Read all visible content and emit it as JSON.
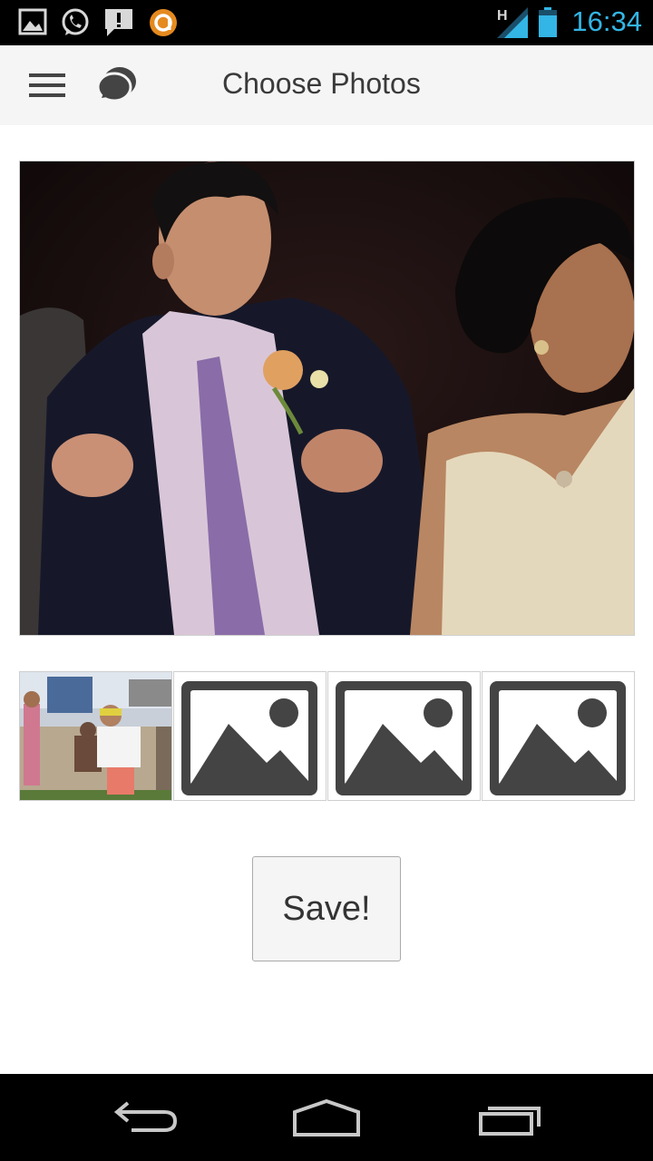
{
  "status_bar": {
    "time": "16:34",
    "network_label": "H",
    "icons": [
      "gallery-icon",
      "whatsapp-icon",
      "alert-icon",
      "avast-icon",
      "signal-icon",
      "battery-icon"
    ]
  },
  "app_bar": {
    "title": "Choose Photos",
    "icons": [
      "menu-icon",
      "chat-icon"
    ]
  },
  "photos": {
    "main": "selected-photo",
    "thumbnails": [
      {
        "type": "photo"
      },
      {
        "type": "placeholder"
      },
      {
        "type": "placeholder"
      },
      {
        "type": "placeholder"
      }
    ]
  },
  "actions": {
    "save_label": "Save!"
  },
  "nav_bar": {
    "icons": [
      "back-icon",
      "home-icon",
      "recents-icon"
    ]
  },
  "colors": {
    "accent": "#33b5e5",
    "app_bar_bg": "#f5f5f5",
    "placeholder_icon": "#444444"
  }
}
